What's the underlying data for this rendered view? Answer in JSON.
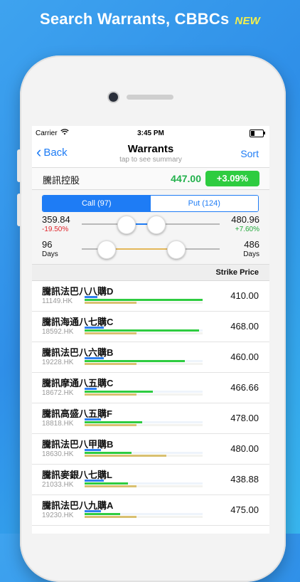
{
  "promo": {
    "headline": "Search Warrants, CBBCs",
    "badge": "NEW"
  },
  "status_bar": {
    "carrier": "Carrier",
    "time": "3:45 PM"
  },
  "nav": {
    "back_label": "Back",
    "title": "Warrants",
    "subtitle": "tap to see summary",
    "sort_label": "Sort"
  },
  "stock": {
    "name": "騰訊控股",
    "price": "447.00",
    "change": "+3.09%"
  },
  "segments": {
    "call": "Call (97)",
    "put": "Put (124)",
    "selected": "call"
  },
  "price_range": {
    "low": "359.84",
    "low_pct": "-19.50%",
    "high": "480.96",
    "high_pct": "+7.60%"
  },
  "days_range": {
    "low": "96",
    "low_unit": "Days",
    "high": "486",
    "high_unit": "Days"
  },
  "table": {
    "header": "Strike Price",
    "rows": [
      {
        "name": "騰訊法巴八八購D",
        "code": "11149.HK",
        "strike": "410.00",
        "b1": 0.11,
        "b2": 1.0,
        "b3": 0.44
      },
      {
        "name": "騰訊海通八七購C",
        "code": "18592.HK",
        "strike": "468.00",
        "b1": 0.16,
        "b2": 0.97,
        "b3": 0.44
      },
      {
        "name": "騰訊法巴八六購B",
        "code": "19228.HK",
        "strike": "460.00",
        "b1": 0.16,
        "b2": 0.85,
        "b3": 0.44
      },
      {
        "name": "騰訊摩通八五購C",
        "code": "18672.HK",
        "strike": "466.66",
        "b1": 0.1,
        "b2": 0.58,
        "b3": 0.44
      },
      {
        "name": "騰訊高盛八五購F",
        "code": "18818.HK",
        "strike": "478.00",
        "b1": 0.14,
        "b2": 0.49,
        "b3": 0.44
      },
      {
        "name": "騰訊法巴八甲購B",
        "code": "18630.HK",
        "strike": "480.00",
        "b1": 0.14,
        "b2": 0.4,
        "b3": 0.69
      },
      {
        "name": "騰訊麥銀八七購L",
        "code": "21033.HK",
        "strike": "438.88",
        "b1": 0.16,
        "b2": 0.37,
        "b3": 0.44
      },
      {
        "name": "騰訊法巴八九購A",
        "code": "19230.HK",
        "strike": "475.00",
        "b1": 0.14,
        "b2": 0.3,
        "b3": 0.44
      }
    ]
  },
  "colors": {
    "accent": "#1e7cf5",
    "up": "#2ecc40",
    "down": "#e0262c",
    "days_track": "#e3b75a"
  }
}
